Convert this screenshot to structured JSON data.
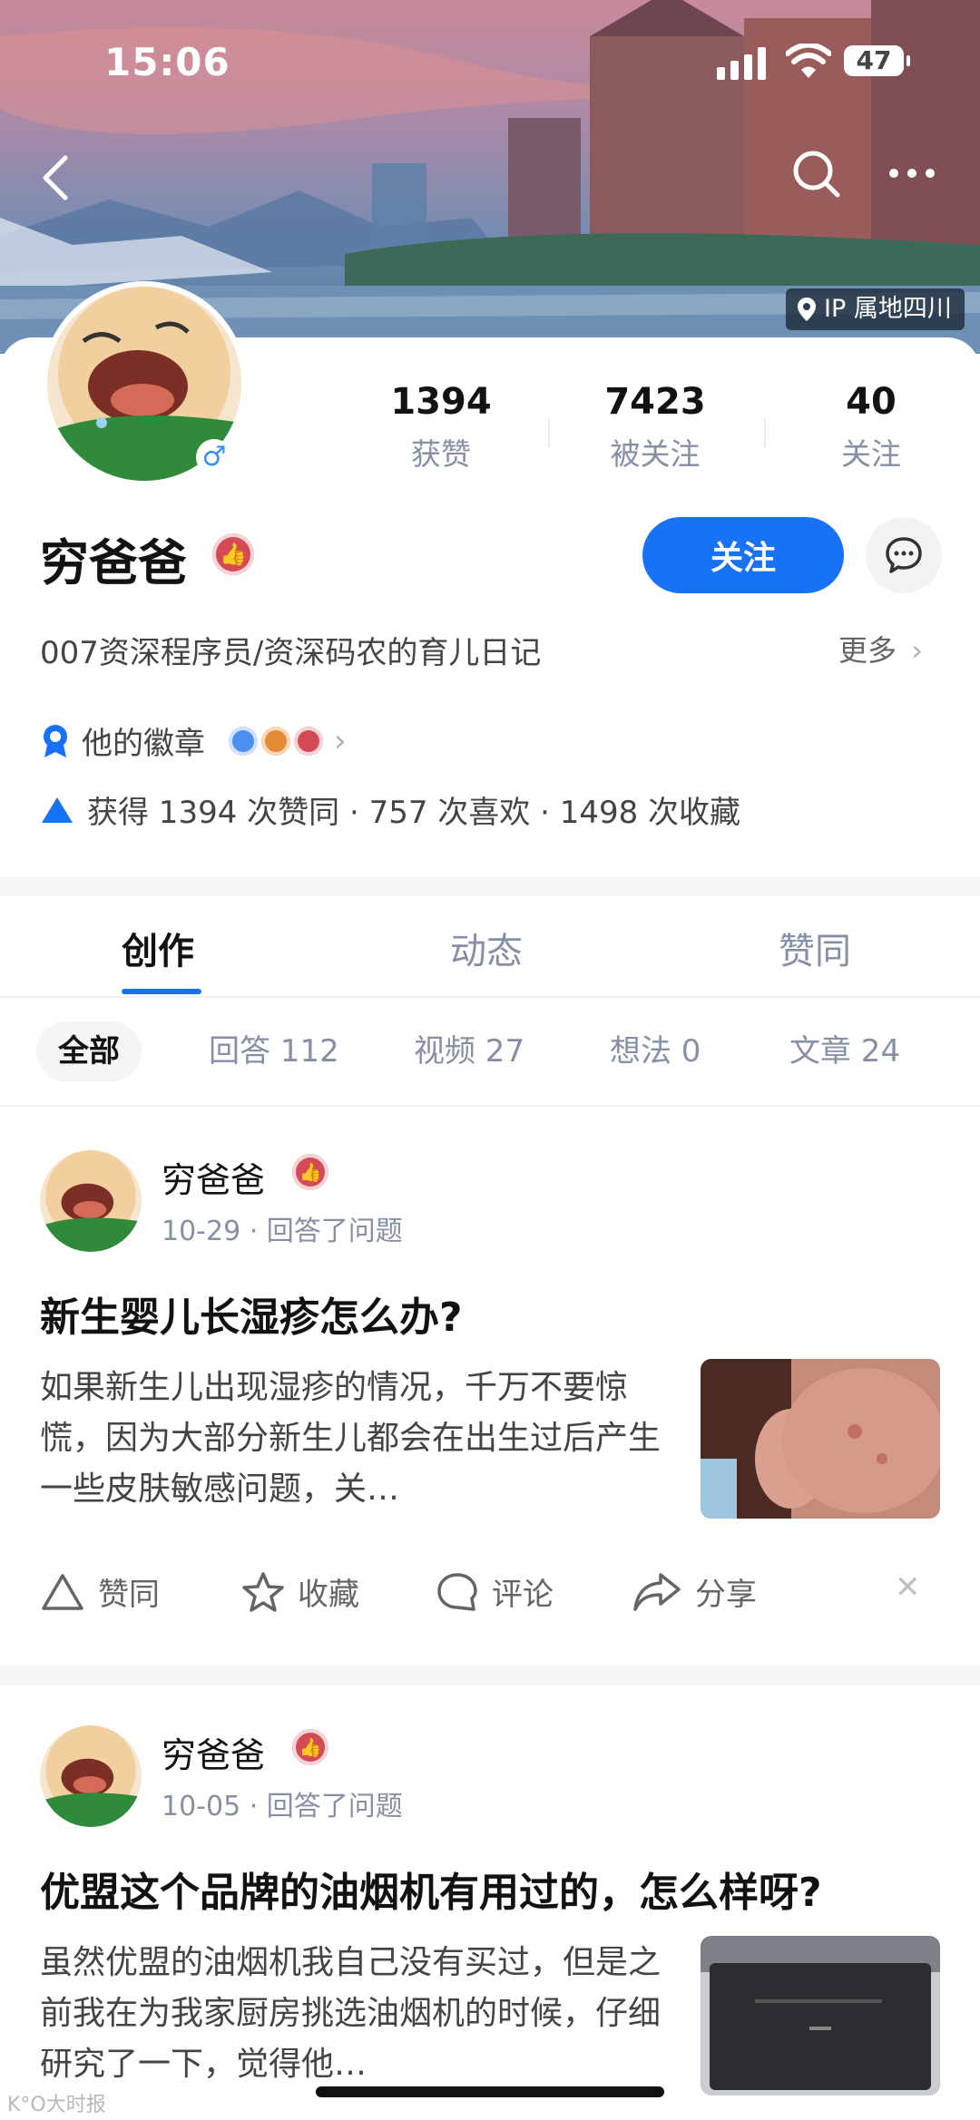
{
  "status": {
    "time": "15:06",
    "battery": "47"
  },
  "location_badge": "IP 属地四川",
  "profile": {
    "name": "穷爸爸",
    "bio": "007资深程序员/资深码农的育儿日记",
    "more_label": "更多",
    "follow_label": "关注",
    "stats": [
      {
        "value": "1394",
        "label": "获赞"
      },
      {
        "value": "7423",
        "label": "被关注"
      },
      {
        "value": "40",
        "label": "关注"
      }
    ],
    "badges_label": "他的徽章",
    "achievements": "获得 1394 次赞同 · 757 次喜欢 · 1498 次收藏"
  },
  "tabs": [
    "创作",
    "动态",
    "赞同"
  ],
  "filters": [
    "全部",
    "回答 112",
    "视频 27",
    "想法 0",
    "文章 24"
  ],
  "posts": [
    {
      "author": "穷爸爸",
      "meta": "10-29 · 回答了问题",
      "title": "新生婴儿长湿疹怎么办?",
      "excerpt": "如果新生儿出现湿疹的情况，千万不要惊慌，因为大部分新生儿都会在出生过后产生一些皮肤敏感问题，关…",
      "thumb": "baby-skin-photo"
    },
    {
      "author": "穷爸爸",
      "meta": "10-05 · 回答了问题",
      "title": "优盟这个品牌的油烟机有用过的，怎么样呀?",
      "excerpt": "虽然优盟的油烟机我自己没有买过，但是之前我在为我家厨房挑选油烟机的时候，仔细研究了一下，觉得他…",
      "thumb": "range-hood-photo"
    }
  ],
  "actions": [
    "赞同",
    "收藏",
    "评论",
    "分享"
  ],
  "watermark": "K°O大时报"
}
